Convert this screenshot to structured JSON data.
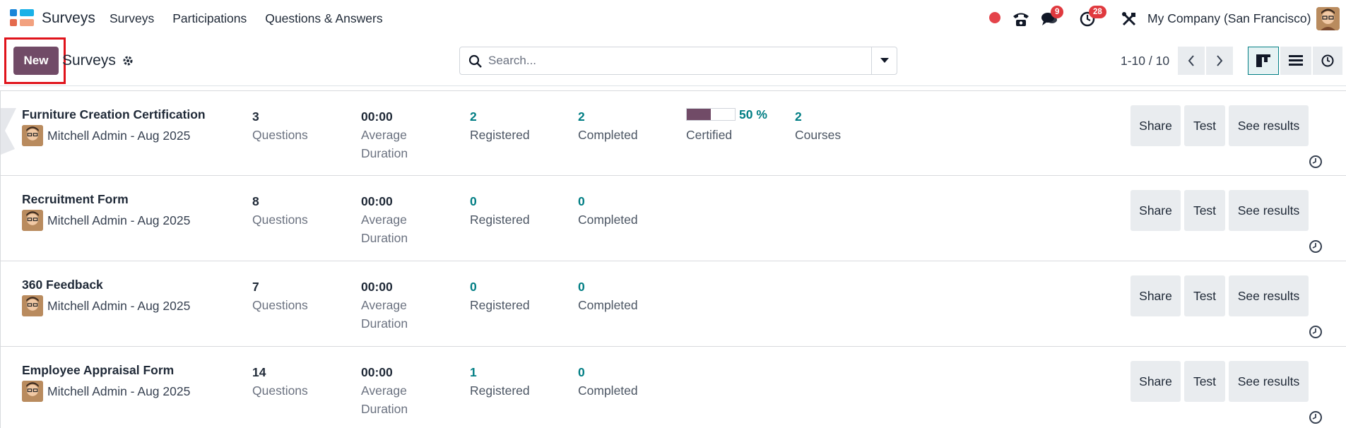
{
  "app": {
    "name": "Surveys",
    "menu": [
      "Surveys",
      "Participations",
      "Questions & Answers"
    ],
    "chat_badge": "9",
    "activity_badge": "28",
    "company": "My Company (San Francisco)"
  },
  "control": {
    "new_label": "New",
    "breadcrumb": "Surveys",
    "search_placeholder": "Search...",
    "pager": "1-10 / 10"
  },
  "colors": {
    "primary": "#714b67",
    "teal": "#017e84",
    "badge": "#e0393e",
    "highlight": "#e0131b"
  },
  "buttons": {
    "share": "Share",
    "test": "Test",
    "results": "See results"
  },
  "surveys": [
    {
      "title": "Furniture Creation Certification",
      "author": "Mitchell Admin - Aug 2025",
      "questions": "3",
      "questions_label": "Questions",
      "duration": "00:00",
      "duration_label1": "Average",
      "duration_label2": "Duration",
      "registered": "2",
      "registered_label": "Registered",
      "completed": "2",
      "completed_label": "Completed",
      "certified_pct": "50 %",
      "certified_value": 0.5,
      "certified_label": "Certified",
      "courses": "2",
      "courses_label": "Courses"
    },
    {
      "title": "Recruitment Form",
      "author": "Mitchell Admin - Aug 2025",
      "questions": "8",
      "questions_label": "Questions",
      "duration": "00:00",
      "duration_label1": "Average",
      "duration_label2": "Duration",
      "registered": "0",
      "registered_label": "Registered",
      "completed": "0",
      "completed_label": "Completed"
    },
    {
      "title": "360 Feedback",
      "author": "Mitchell Admin - Aug 2025",
      "questions": "7",
      "questions_label": "Questions",
      "duration": "00:00",
      "duration_label1": "Average",
      "duration_label2": "Duration",
      "registered": "0",
      "registered_label": "Registered",
      "completed": "0",
      "completed_label": "Completed"
    },
    {
      "title": "Employee Appraisal Form",
      "author": "Mitchell Admin - Aug 2025",
      "questions": "14",
      "questions_label": "Questions",
      "duration": "00:00",
      "duration_label1": "Average",
      "duration_label2": "Duration",
      "registered": "1",
      "registered_label": "Registered",
      "completed": "0",
      "completed_label": "Completed"
    }
  ]
}
